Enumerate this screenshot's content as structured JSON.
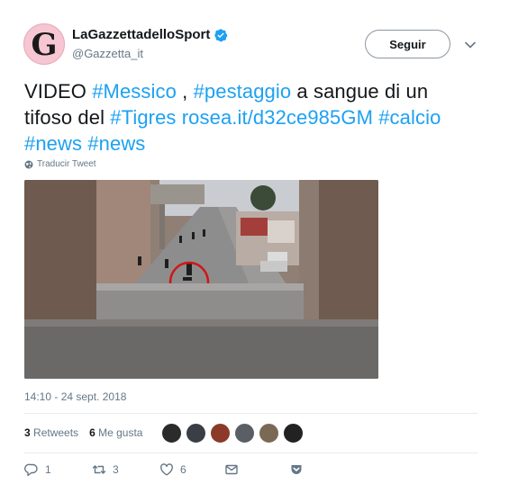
{
  "author": {
    "display_name": "LaGazzettadelloSport",
    "handle": "@Gazzetta_it",
    "avatar_letter": "G",
    "verified": true
  },
  "follow_button": {
    "label": "Seguir"
  },
  "tweet": {
    "parts": [
      {
        "text": "VIDEO ",
        "link": false
      },
      {
        "text": "#Messico",
        "link": true
      },
      {
        "text": " , ",
        "link": false
      },
      {
        "text": "#pestaggio",
        "link": true
      },
      {
        "text": " a sangue di un tifoso del ",
        "link": false
      },
      {
        "text": "#Tigres",
        "link": true
      },
      {
        "text": " ",
        "link": false
      },
      {
        "text": "rosea.it/d32ce985GM",
        "link": true
      },
      {
        "text": " ",
        "link": false
      },
      {
        "text": "#calcio",
        "link": true
      },
      {
        "text": " ",
        "link": false
      },
      {
        "text": "#news",
        "link": true
      },
      {
        "text": " ",
        "link": false
      },
      {
        "text": "#news",
        "link": true
      }
    ]
  },
  "translate": {
    "label": "Traducir Tweet",
    "icon": "globe-icon"
  },
  "media": {
    "type": "video-thumbnail"
  },
  "timestamp": "14:10 - 24 sept. 2018",
  "stats": {
    "retweets_count": "3",
    "retweets_label": "Retweets",
    "likes_count": "6",
    "likes_label": "Me gusta"
  },
  "likers": [
    "#2b2b2b",
    "#3a3f45",
    "#8b3a2a",
    "#5a5f66",
    "#7a6a55",
    "#222222"
  ],
  "actions": {
    "reply_count": "1",
    "retweet_count": "3",
    "like_count": "6"
  },
  "colors": {
    "link": "#1da1f2",
    "secondary": "#657786",
    "text": "#14171a",
    "verified": "#1da1f2"
  }
}
